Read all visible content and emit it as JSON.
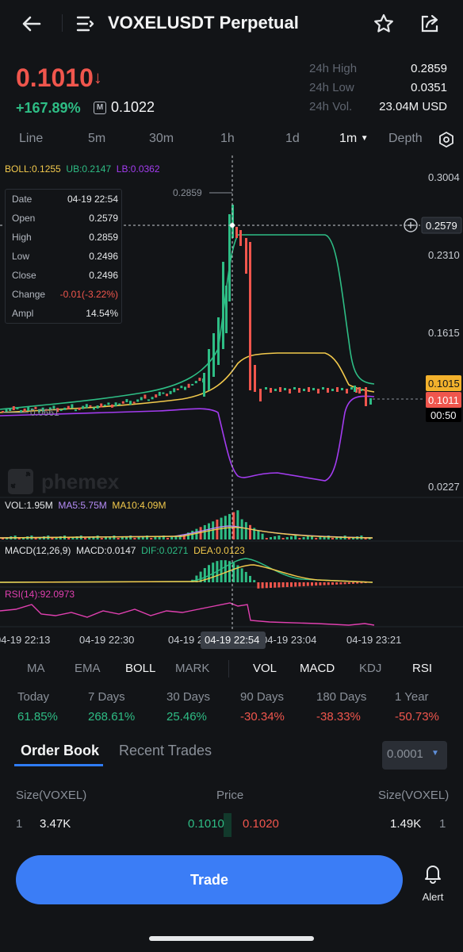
{
  "header": {
    "title": "VOXELUSDT Perpetual"
  },
  "ticker": {
    "last_price": "0.1010",
    "direction_arrow": "↓",
    "change_pct": "+167.89%",
    "mark_badge": "M",
    "mark_price": "0.1022",
    "stats": [
      {
        "label": "24h High",
        "value": "0.2859"
      },
      {
        "label": "24h Low",
        "value": "0.0351"
      },
      {
        "label": "24h Vol.",
        "value": "23.04M USD"
      }
    ]
  },
  "time_tabs": {
    "items": [
      "Line",
      "5m",
      "30m",
      "1h",
      "1d",
      "1m",
      "Depth"
    ],
    "active": "1m"
  },
  "chart": {
    "legend": {
      "boll": "BOLL:0.1255",
      "ub": "UB:0.2147",
      "lb": "LB:0.0362"
    },
    "price_axis": [
      "0.3004",
      "0.2310",
      "0.1615",
      "0.0227"
    ],
    "high_marker": "0.2859",
    "low_marker": "0.0661",
    "crosshair_price": "0.2579",
    "last_price_tag": "0.1011",
    "ub_price_tag": "0.1015",
    "countdown": "00:50",
    "watermark": "phemex",
    "vol_legend": {
      "vol": "VOL:1.95M",
      "ma5": "MA5:5.75M",
      "ma10": "MA10:4.09M"
    },
    "macd_legend": {
      "params": "MACD(12,26,9)",
      "macd": "MACD:0.0147",
      "dif": "DIF:0.0271",
      "dea": "DEA:0.0123"
    },
    "rsi_legend": "RSI(14):92.0973",
    "time_axis": [
      "04-19 22:13",
      "04-19 22:30",
      "04-19 2",
      "04-19 23:04",
      "04-19 23:21"
    ],
    "crosshair_time": "04-19 22:54",
    "colors": {
      "up": "#2ebd85",
      "down": "#f0564d",
      "boll": "#f2c94c",
      "ub": "#2ebd85",
      "lb": "#a33cf0",
      "ma5": "#b58cf6",
      "ma10": "#f2c94c",
      "rsi": "#e040b0"
    }
  },
  "info_box": [
    {
      "k": "Date",
      "v": "04-19 22:54"
    },
    {
      "k": "Open",
      "v": "0.2579"
    },
    {
      "k": "High",
      "v": "0.2859"
    },
    {
      "k": "Low",
      "v": "0.2496"
    },
    {
      "k": "Close",
      "v": "0.2496"
    },
    {
      "k": "Change",
      "v": "-0.01(-3.22%)"
    },
    {
      "k": "Ampl",
      "v": "14.54%"
    }
  ],
  "indicator_tabs": {
    "main": [
      "MA",
      "EMA",
      "BOLL",
      "MARK"
    ],
    "sub": [
      "VOL",
      "MACD",
      "KDJ",
      "RSI"
    ],
    "active": [
      "BOLL",
      "VOL",
      "MACD",
      "RSI"
    ]
  },
  "performance": [
    {
      "label": "Today",
      "value": "61.85%",
      "dir": "up"
    },
    {
      "label": "7 Days",
      "value": "268.61%",
      "dir": "up"
    },
    {
      "label": "30 Days",
      "value": "25.46%",
      "dir": "up"
    },
    {
      "label": "90 Days",
      "value": "-30.34%",
      "dir": "down"
    },
    {
      "label": "180 Days",
      "value": "-38.33%",
      "dir": "down"
    },
    {
      "label": "1 Year",
      "value": "-50.73%",
      "dir": "down"
    }
  ],
  "order_book": {
    "tabs": [
      "Order Book",
      "Recent Trades"
    ],
    "active_tab": "Order Book",
    "precision": "0.0001",
    "headers": {
      "bid_size": "Size(VOXEL)",
      "price": "Price",
      "ask_size": "Size(VOXEL)"
    },
    "row": {
      "bid_idx": "1",
      "bid_size": "3.47K",
      "bid_price": "0.1010",
      "ask_price": "0.1020",
      "ask_size": "1.49K",
      "ask_idx": "1"
    }
  },
  "footer": {
    "trade_label": "Trade",
    "alert_label": "Alert"
  }
}
